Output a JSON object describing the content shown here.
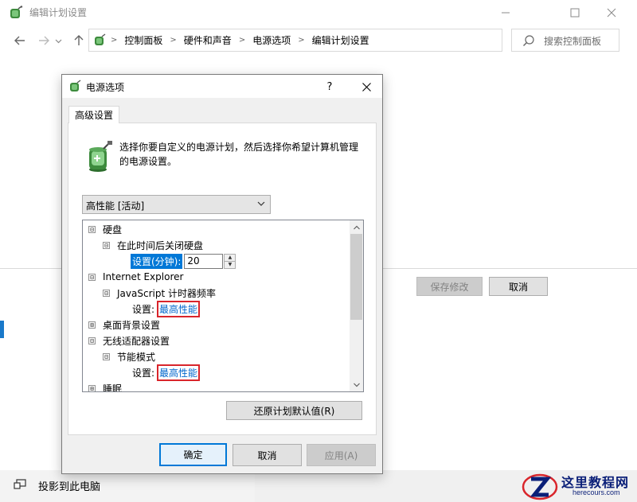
{
  "window": {
    "title": "编辑计划设置",
    "minimize_icon": "minimize-icon",
    "maximize_icon": "maximize-icon",
    "close_icon": "close-icon"
  },
  "address": {
    "breadcrumbs": [
      "控制面板",
      "硬件和声音",
      "电源选项",
      "编辑计划设置"
    ],
    "search_placeholder": "搜索控制面板"
  },
  "main": {
    "save_label": "保存修改",
    "cancel_label": "取消",
    "project_label": "投影到此电脑"
  },
  "dialog": {
    "title": "电源选项",
    "help_label": "?",
    "tab_label": "高级设置",
    "description": "选择你要自定义的电源计划，然后选择你希望计算机管理的电源设置。",
    "plan_selected": "高性能 [活动]",
    "tree": [
      {
        "label": "硬盘",
        "toggle": "⊟"
      },
      {
        "label": "在此时间后关闭硬盘",
        "toggle": "⊟"
      },
      {
        "setting_label": "设置(分钟):",
        "value": "20"
      },
      {
        "label": "Internet Explorer",
        "toggle": "⊟"
      },
      {
        "label": "JavaScript 计时器频率",
        "toggle": "⊟"
      },
      {
        "setting_label": "设置:",
        "value": "最高性能"
      },
      {
        "label": "桌面背景设置",
        "toggle": "⊞"
      },
      {
        "label": "无线适配器设置",
        "toggle": "⊟"
      },
      {
        "label": "节能模式",
        "toggle": "⊟"
      },
      {
        "setting_label": "设置:",
        "value": "最高性能"
      },
      {
        "label": "睡眠",
        "toggle": "⊞"
      }
    ],
    "restore_label": "还原计划默认值(R)",
    "ok_label": "确定",
    "cancel_label": "取消",
    "apply_label": "应用(A)"
  },
  "watermark": {
    "title": "这里教程网",
    "url": "herecours.com"
  },
  "colors": {
    "accent": "#0078d7",
    "highlight_box": "#d9252b",
    "link": "#0066cc"
  }
}
